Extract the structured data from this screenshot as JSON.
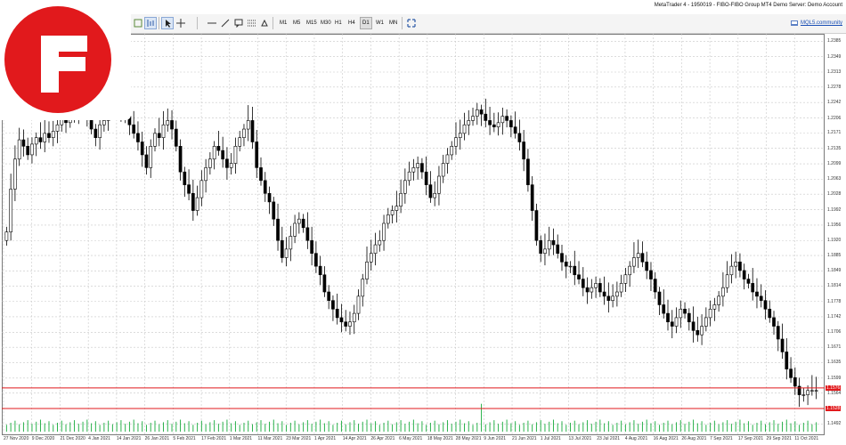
{
  "window": {
    "title": "MetaTrader 4 - 1950019 - FIBO-FIBO Group MT4 Demo Server: Demo Account"
  },
  "toolbar": {
    "timeframes": [
      "M1",
      "M5",
      "M15",
      "M30",
      "H1",
      "H4",
      "D1",
      "W1",
      "MN"
    ],
    "active_timeframe": "D1",
    "community_link": "MQL5.community"
  },
  "logo": {
    "letter": "F",
    "color": "#e1191c"
  },
  "colors": {
    "bull_fill": "#ffffff",
    "bear_fill": "#000000",
    "grid": "#c8c8c8",
    "level_line": "#e1191c",
    "volume": "#2bb24c"
  },
  "chart_data": {
    "type": "candlestick",
    "symbol_timeframe": "D1",
    "y_ticks": [
      "1.2385",
      "1.2349",
      "1.2313",
      "1.2278",
      "1.2242",
      "1.2206",
      "1.2171",
      "1.2135",
      "1.2099",
      "1.2063",
      "1.2028",
      "1.1992",
      "1.1956",
      "1.1920",
      "1.1885",
      "1.1849",
      "1.1814",
      "1.1778",
      "1.1742",
      "1.1706",
      "1.1671",
      "1.1635",
      "1.1599",
      "1.1564",
      "1.1492"
    ],
    "ylim": [
      1.1474,
      1.2394
    ],
    "x_ticks": [
      "27 Nov 2020",
      "9 Dec 2020",
      "21 Dec 2020",
      "4 Jan 2021",
      "14 Jan 2021",
      "26 Jan 2021",
      "5 Feb 2021",
      "17 Feb 2021",
      "1 Mar 2021",
      "11 Mar 2021",
      "23 Mar 2021",
      "1 Apr 2021",
      "14 Apr 2021",
      "26 Apr 2021",
      "6 May 2021",
      "18 May 2021",
      "28 May 2021",
      "9 Jun 2021",
      "21 Jun 2021",
      "1 Jul 2021",
      "13 Jul 2021",
      "23 Jul 2021",
      "4 Aug 2021",
      "16 Aug 2021",
      "26 Aug 2021",
      "7 Sep 2021",
      "17 Sep 2021",
      "29 Sep 2021",
      "11 Oct 2021"
    ],
    "horizontal_levels": [
      {
        "value": 1.1576,
        "label": "1.1576"
      },
      {
        "value": 1.1528,
        "label": "1.1528"
      }
    ],
    "close_series": [
      1.194,
      1.204,
      1.211,
      1.2155,
      1.214,
      1.212,
      1.2145,
      1.216,
      1.215,
      1.217,
      1.216,
      1.2175,
      1.219,
      1.2205,
      1.2195,
      1.2215,
      1.222,
      1.2235,
      1.224,
      1.221,
      1.218,
      1.216,
      1.219,
      1.22,
      1.222,
      1.223,
      1.224,
      1.2225,
      1.221,
      1.219,
      1.217,
      1.215,
      1.212,
      1.209,
      1.214,
      1.217,
      1.216,
      1.219,
      1.22,
      1.218,
      1.214,
      1.208,
      1.205,
      1.203,
      1.199,
      1.202,
      1.206,
      1.209,
      1.211,
      1.214,
      1.213,
      1.211,
      1.209,
      1.21,
      1.214,
      1.216,
      1.218,
      1.22,
      1.215,
      1.209,
      1.206,
      1.203,
      1.201,
      1.197,
      1.192,
      1.188,
      1.19,
      1.193,
      1.196,
      1.197,
      1.195,
      1.192,
      1.189,
      1.186,
      1.184,
      1.18,
      1.178,
      1.176,
      1.174,
      1.173,
      1.172,
      1.173,
      1.175,
      1.179,
      1.183,
      1.187,
      1.189,
      1.191,
      1.192,
      1.196,
      1.198,
      1.199,
      1.2,
      1.203,
      1.206,
      1.208,
      1.209,
      1.21,
      1.208,
      1.205,
      1.202,
      1.203,
      1.207,
      1.21,
      1.212,
      1.214,
      1.216,
      1.217,
      1.219,
      1.22,
      1.221,
      1.2225,
      1.2215,
      1.22,
      1.219,
      1.2185,
      1.2195,
      1.221,
      1.22,
      1.2185,
      1.217,
      1.215,
      1.211,
      1.205,
      1.199,
      1.192,
      1.189,
      1.19,
      1.192,
      1.191,
      1.189,
      1.187,
      1.186,
      1.186,
      1.184,
      1.183,
      1.181,
      1.18,
      1.181,
      1.182,
      1.18,
      1.179,
      1.178,
      1.179,
      1.18,
      1.182,
      1.184,
      1.186,
      1.188,
      1.189,
      1.187,
      1.185,
      1.183,
      1.18,
      1.177,
      1.175,
      1.173,
      1.172,
      1.174,
      1.176,
      1.175,
      1.173,
      1.171,
      1.17,
      1.172,
      1.174,
      1.176,
      1.177,
      1.179,
      1.181,
      1.184,
      1.186,
      1.187,
      1.185,
      1.183,
      1.182,
      1.18,
      1.179,
      1.178,
      1.176,
      1.174,
      1.172,
      1.169,
      1.166,
      1.162,
      1.16,
      1.158,
      1.156,
      1.156,
      1.157,
      1.157,
      1.157
    ]
  }
}
